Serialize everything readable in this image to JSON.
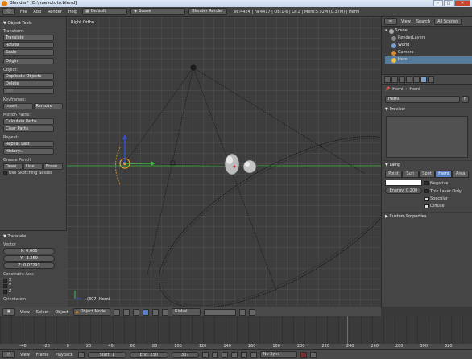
{
  "window": {
    "title": "Blender* [D:\\nuevotuto.blend]"
  },
  "info_header": {
    "menus": [
      "File",
      "Add",
      "Render",
      "Help"
    ],
    "layout": "Default",
    "scene": "Scene",
    "engine": "Blender Render",
    "stats": "Ve:4424 | Fa:4417 | Ob:1-6 | La:2 | Mem:5.92M (0.37M) | Hemi"
  },
  "toolshelf": {
    "title": "Object Tools",
    "transform_label": "Transform:",
    "transform_buttons": [
      "Translate",
      "Rotate",
      "Scale"
    ],
    "origin_button": "Origin",
    "object_label": "Object:",
    "object_buttons": [
      "Duplicate Objects",
      "Delete",
      "Join"
    ],
    "keyframes_label": "Keyframes:",
    "keyframe_insert": "Insert",
    "keyframe_remove": "Remove",
    "motion_label": "Motion Paths:",
    "motion_buttons": [
      "Calculate Paths",
      "Clear Paths"
    ],
    "repeat_label": "Repeat:",
    "repeat_buttons": [
      "Repeat Last",
      "History..."
    ],
    "grease_label": "Grease Pencil:",
    "grease_buttons": [
      "Draw",
      "Line",
      "Erase"
    ],
    "sketch_session": "Use Sketching Sessio"
  },
  "redo_panel": {
    "title": "Translate",
    "vector_label": "Vector",
    "x": "X: 0.000",
    "y": "Y: -3.259",
    "z": "Z: 0.07293",
    "constraint_label": "Constraint Axis",
    "axes": [
      "X",
      "Y",
      "Z"
    ],
    "orientation_label": "Orientation"
  },
  "viewport": {
    "view_name": "Right Ortho",
    "object_info": "(307) Hemi"
  },
  "view3d_header": {
    "menus": [
      "View",
      "Select",
      "Object"
    ],
    "mode": "Object Mode",
    "orientation": "Global"
  },
  "timeline": {
    "ticks": [
      "-40",
      "-20",
      "0",
      "20",
      "40",
      "60",
      "80",
      "100",
      "120",
      "140",
      "160",
      "180",
      "200",
      "220",
      "240",
      "260",
      "280",
      "300",
      "320"
    ],
    "menus": [
      "View",
      "Frame",
      "Playback"
    ],
    "start": "Start: 1",
    "end": "End: 250",
    "current": "307",
    "sync": "No Sync"
  },
  "outliner": {
    "header_menus": [
      "View",
      "Search"
    ],
    "scope": "All Scenes",
    "items": [
      "Scene",
      "RenderLayers",
      "World",
      "Camera",
      "Hemi"
    ]
  },
  "properties": {
    "breadcrumb": [
      "Hemi",
      "Hemi"
    ],
    "datablock_name": "Hemi",
    "datablock_flag": "F",
    "preview_label": "Preview",
    "lamp_label": "Lamp",
    "lamp_types": [
      "Point",
      "Sun",
      "Spot",
      "Hemi",
      "Area"
    ],
    "energy": "Energy: 0.200",
    "options": [
      "Negative",
      "This Layer Only",
      "Specular",
      "Diffuse"
    ],
    "custom_props": "Custom Properties"
  }
}
